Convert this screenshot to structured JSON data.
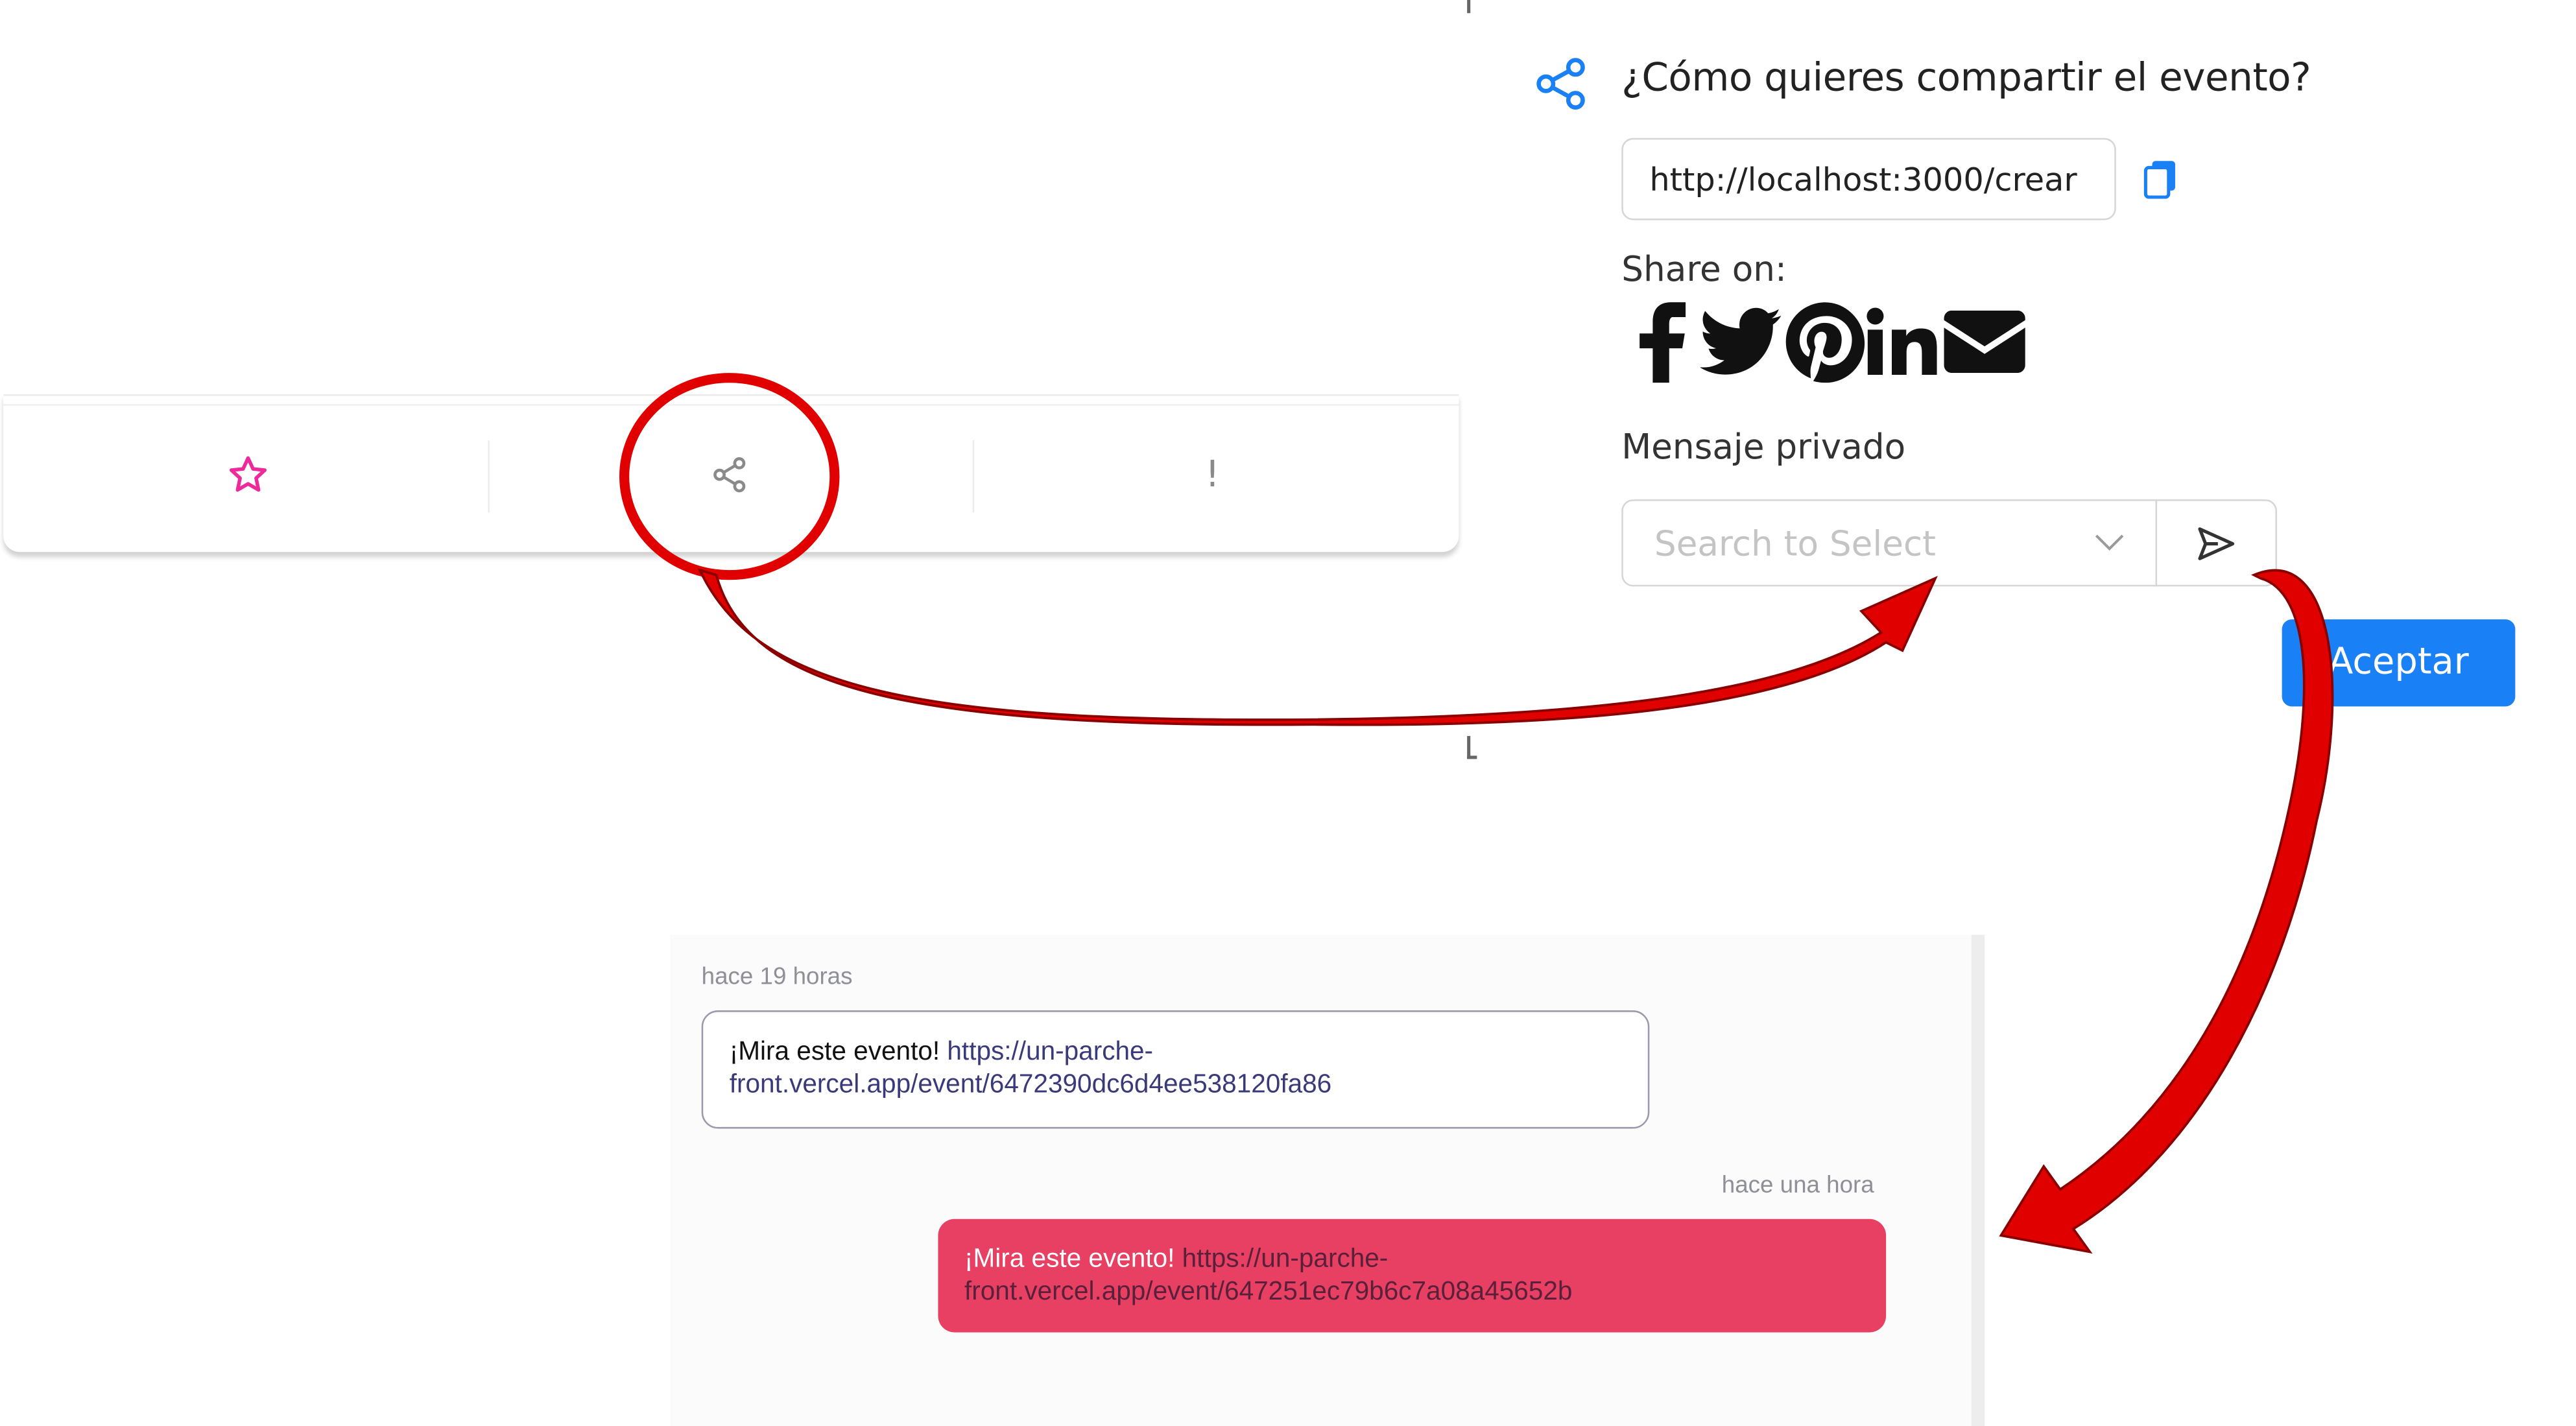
{
  "card": {
    "favorite_icon": "star-icon",
    "share_icon": "share-icon",
    "report_label": "!"
  },
  "modal": {
    "title": "¿Cómo quieres compartir el evento?",
    "header_icon": "share-icon",
    "url_value": "http://localhost:3000/crear",
    "copy_icon": "copy-icon",
    "share_on_label": "Share on:",
    "social": [
      "facebook",
      "twitter",
      "pinterest",
      "linkedin",
      "email"
    ],
    "private_message_label": "Mensaje privado",
    "select_placeholder": "Search to Select",
    "accept_label": "Aceptar",
    "accent_color": "#1a80f5"
  },
  "chat": {
    "messages": [
      {
        "time": "hace 19 horas",
        "text": "¡Mira este evento! ",
        "link": "https://un-parche-front.vercel.app/event/6472390dc6d4ee538120fa86",
        "direction": "incoming"
      },
      {
        "time": "hace una hora",
        "text": "¡Mira este evento! ",
        "link": "https://un-parche-front.vercel.app/event/647251ec79b6c7a08a45652b",
        "direction": "outgoing",
        "color": "#e84062"
      }
    ]
  },
  "annotation": {
    "highlight_color": "#e00000"
  }
}
